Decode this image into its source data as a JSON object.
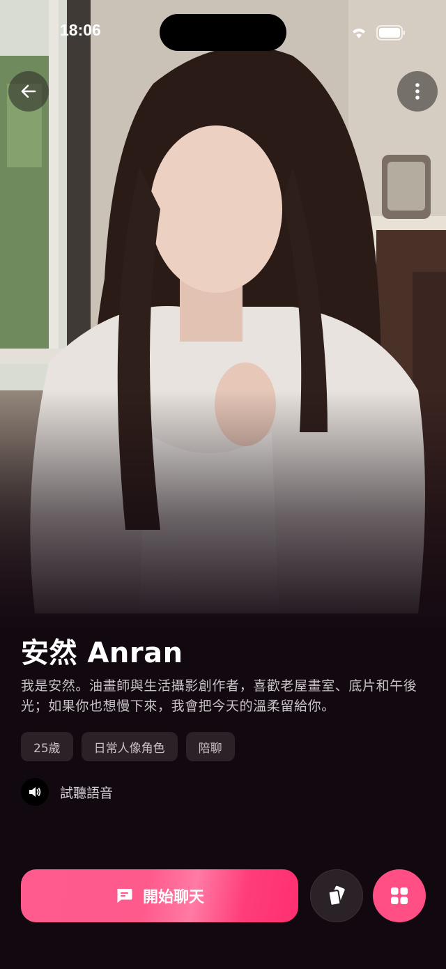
{
  "status_bar": {
    "time": "18:06"
  },
  "header": {
    "back_icon": "arrow-left-icon",
    "more_icon": "more-vertical-icon"
  },
  "profile": {
    "name": "安然 Anran",
    "bio": "我是安然。油畫師與生活攝影創作者，喜歡老屋畫室、底片和午後光；如果你也想慢下來，我會把今天的溫柔留給你。",
    "tags": [
      "25歲",
      "日常人像角色",
      "陪聊"
    ],
    "voice_label": "試聽語音"
  },
  "actions": {
    "chat_label": "開始聊天",
    "chat_icon": "chat-bubble-icon",
    "cards_icon": "cards-icon",
    "grid_icon": "grid-icon"
  },
  "colors": {
    "background": "#120810",
    "accent": "#ff4f84",
    "tag_bg": "#2a2226"
  }
}
